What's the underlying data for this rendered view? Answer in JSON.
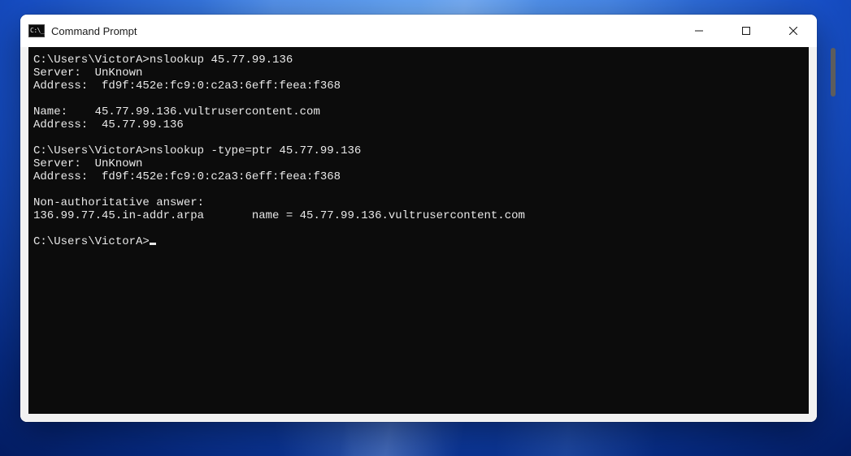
{
  "window": {
    "title": "Command Prompt"
  },
  "terminal": {
    "lines": [
      {
        "prompt": "C:\\Users\\VictorA>",
        "cmd": "nslookup 45.77.99.136"
      },
      {
        "text": "Server:  UnKnown"
      },
      {
        "text": "Address:  fd9f:452e:fc9:0:c2a3:6eff:feea:f368"
      },
      {
        "text": ""
      },
      {
        "text": "Name:    45.77.99.136.vultrusercontent.com"
      },
      {
        "text": "Address:  45.77.99.136"
      },
      {
        "text": ""
      },
      {
        "prompt": "C:\\Users\\VictorA>",
        "cmd": "nslookup -type=ptr 45.77.99.136"
      },
      {
        "text": "Server:  UnKnown"
      },
      {
        "text": "Address:  fd9f:452e:fc9:0:c2a3:6eff:feea:f368"
      },
      {
        "text": ""
      },
      {
        "text": "Non-authoritative answer:"
      },
      {
        "text": "136.99.77.45.in-addr.arpa       name = 45.77.99.136.vultrusercontent.com"
      },
      {
        "text": ""
      },
      {
        "prompt": "C:\\Users\\VictorA>",
        "cursor": true
      }
    ]
  }
}
